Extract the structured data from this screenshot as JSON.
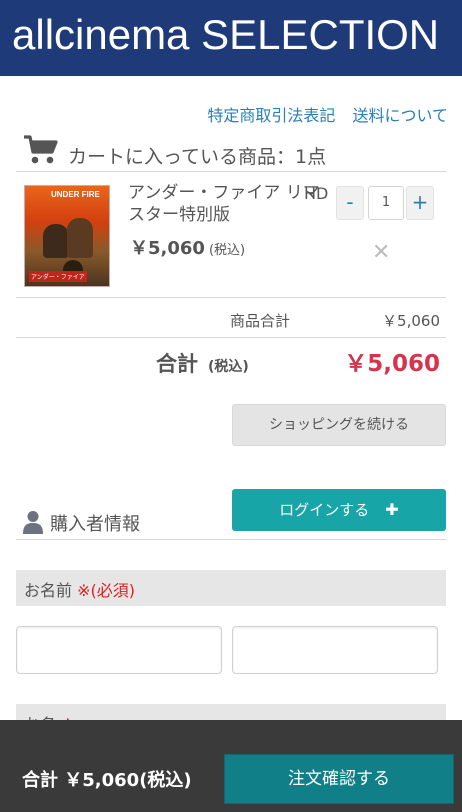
{
  "header": {
    "brand": "allcinema SELECTION"
  },
  "links": {
    "tokusho": "特定商取引法表記",
    "shipping": "送料について"
  },
  "cart": {
    "title": "カートに入っている商品：1点",
    "item": {
      "name": "アンダー・ファイア リマスター特別版",
      "format": "HD",
      "price": "￥5,060",
      "tax_note": "(税込)",
      "quantity": "1",
      "poster_title": "UNDER FIRE",
      "poster_footer": "アンダー・ファイア"
    },
    "subtotal_label": "商品合計",
    "subtotal_value": "￥5,060",
    "total_label": "合計",
    "total_tax_note": "(税込)",
    "total_value": "￥5,060",
    "continue_label": "ショッピングを続ける"
  },
  "buyer": {
    "section_title": "購入者情報",
    "login_label": "ログインする",
    "login_plus": "✚",
    "name_field_label": "お名前",
    "required_mark": "※(必須)",
    "next_field_label": "お名",
    "next_required_mark": "※"
  },
  "footer": {
    "summary": "合計 ￥5,060(税込)",
    "order_button": "注文確認する"
  },
  "colors": {
    "header_bg": "#1f3a78",
    "accent": "#17a5a7",
    "price_red": "#d6334c",
    "footer_bg": "#3a3a3a",
    "order_bg": "#117f87"
  },
  "icons": {
    "cart": "cart-icon",
    "person": "person-icon",
    "remove": "close-icon"
  }
}
